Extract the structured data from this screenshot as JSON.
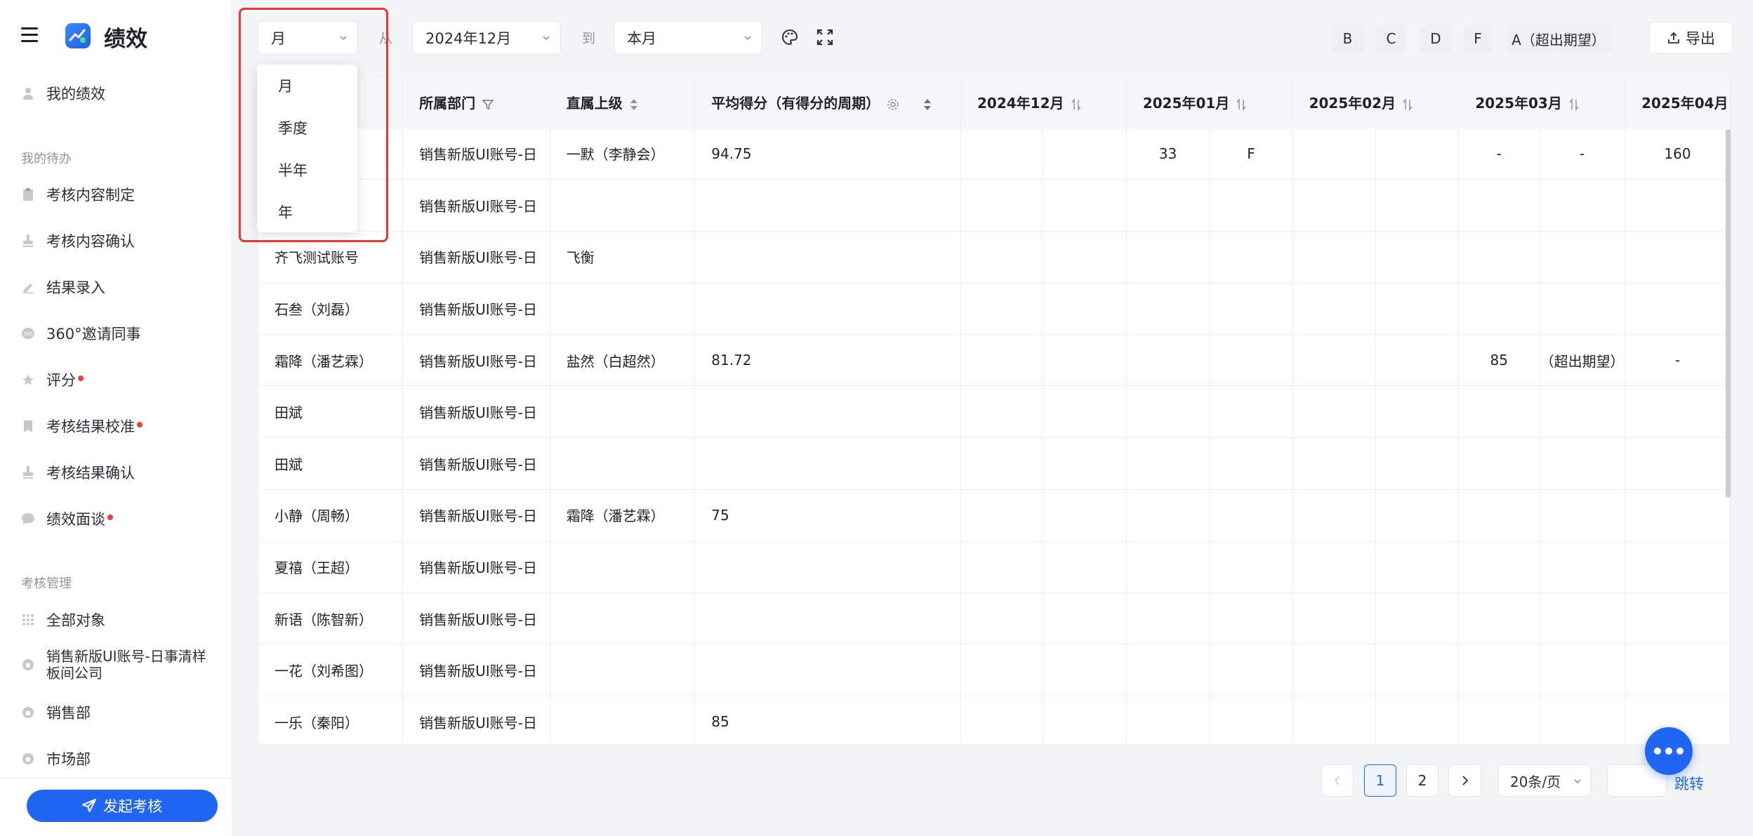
{
  "app": {
    "title": "绩效"
  },
  "sidebar": {
    "my_perf": "我的绩效",
    "todo_title": "我的待办",
    "todo_items": [
      {
        "label": "考核内容制定",
        "dot": false
      },
      {
        "label": "考核内容确认",
        "dot": false
      },
      {
        "label": "结果录入",
        "dot": false
      },
      {
        "label": "360°邀请同事",
        "dot": false
      },
      {
        "label": "评分",
        "dot": true
      },
      {
        "label": "考核结果校准",
        "dot": true
      },
      {
        "label": "考核结果确认",
        "dot": false
      },
      {
        "label": "绩效面谈",
        "dot": true
      }
    ],
    "manage_title": "考核管理",
    "manage_items": [
      "全部对象",
      "销售新版UI账号-日事清样板间公司",
      "销售部",
      "市场部"
    ],
    "launch_label": "发起考核"
  },
  "toolbar": {
    "period_value": "月",
    "from_label": "从",
    "from_value": "2024年12月",
    "to_label": "到",
    "to_value": "本月",
    "grades": [
      "B",
      "C",
      "D",
      "F",
      "A（超出期望）"
    ],
    "export_label": "导出"
  },
  "period_dropdown": {
    "options": [
      "月",
      "季度",
      "半年",
      "年"
    ]
  },
  "table": {
    "headers": [
      "",
      "所属部门",
      "直属上级",
      "平均得分（有得分的周期）",
      "2024年12月",
      "2025年01月",
      "2025年02月",
      "2025年03月",
      "2025年04月"
    ],
    "rows": [
      {
        "name": "",
        "dept": "销售新版UI账号-日",
        "leader": "一默（李静会）",
        "avg": "94.75",
        "cells": [
          "",
          "",
          "33",
          "F",
          "",
          "",
          "-",
          "-",
          "160"
        ]
      },
      {
        "name": "）",
        "dept": "销售新版UI账号-日",
        "leader": "",
        "avg": "",
        "cells": [
          "",
          "",
          "",
          "",
          "",
          "",
          "",
          "",
          ""
        ]
      },
      {
        "name": "齐飞测试账号",
        "dept": "销售新版UI账号-日",
        "leader": "飞衡",
        "avg": "",
        "cells": [
          "",
          "",
          "",
          "",
          "",
          "",
          "",
          "",
          ""
        ]
      },
      {
        "name": "石叁（刘磊）",
        "dept": "销售新版UI账号-日",
        "leader": "",
        "avg": "",
        "cells": [
          "",
          "",
          "",
          "",
          "",
          "",
          "",
          "",
          ""
        ]
      },
      {
        "name": "霜降（潘艺霖）",
        "dept": "销售新版UI账号-日",
        "leader": "盐然（白超然）",
        "avg": "81.72",
        "cells": [
          "",
          "",
          "",
          "",
          "",
          "",
          "85",
          "（超出期望）",
          "-"
        ]
      },
      {
        "name": "田斌",
        "dept": "销售新版UI账号-日",
        "leader": "",
        "avg": "",
        "cells": [
          "",
          "",
          "",
          "",
          "",
          "",
          "",
          "",
          ""
        ]
      },
      {
        "name": "田斌",
        "dept": "销售新版UI账号-日",
        "leader": "",
        "avg": "",
        "cells": [
          "",
          "",
          "",
          "",
          "",
          "",
          "",
          "",
          ""
        ]
      },
      {
        "name": "小静（周畅）",
        "dept": "销售新版UI账号-日",
        "leader": "霜降（潘艺霖）",
        "avg": "75",
        "cells": [
          "",
          "",
          "",
          "",
          "",
          "",
          "",
          "",
          ""
        ]
      },
      {
        "name": "夏禧（王超）",
        "dept": "销售新版UI账号-日",
        "leader": "",
        "avg": "",
        "cells": [
          "",
          "",
          "",
          "",
          "",
          "",
          "",
          "",
          ""
        ]
      },
      {
        "name": "新语（陈智新）",
        "dept": "销售新版UI账号-日",
        "leader": "",
        "avg": "",
        "cells": [
          "",
          "",
          "",
          "",
          "",
          "",
          "",
          "",
          ""
        ]
      },
      {
        "name": "一花（刘希图）",
        "dept": "销售新版UI账号-日",
        "leader": "",
        "avg": "",
        "cells": [
          "",
          "",
          "",
          "",
          "",
          "",
          "",
          "",
          ""
        ]
      },
      {
        "name": "一乐（秦阳）",
        "dept": "销售新版UI账号-日",
        "leader": "",
        "avg": "85",
        "cells": [
          "",
          "",
          "",
          "",
          "",
          "",
          "",
          "",
          ""
        ]
      }
    ]
  },
  "pagination": {
    "pages": [
      "1",
      "2"
    ],
    "page_size": "20条/页",
    "jump_label": "跳转",
    "jump_placeholder": ""
  }
}
